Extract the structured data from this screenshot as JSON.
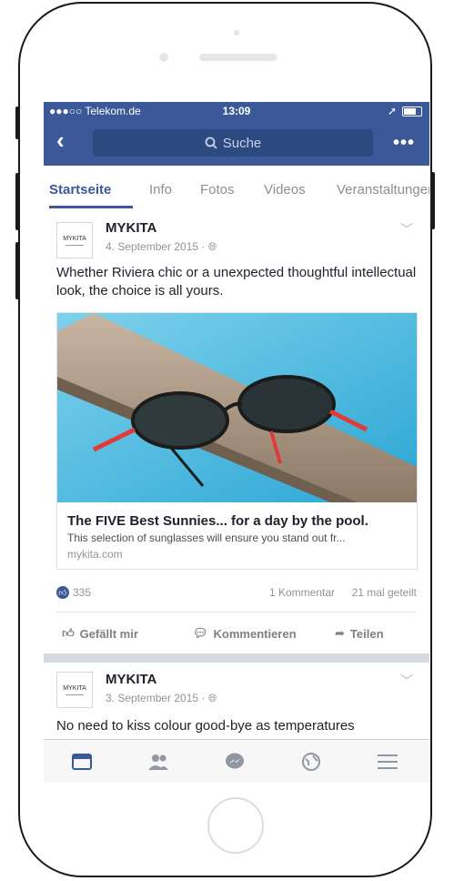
{
  "status_bar": {
    "carrier": "●●●○○ Telekom.de",
    "time": "13:09"
  },
  "navbar": {
    "search_placeholder": "Suche"
  },
  "tabs": [
    {
      "label": "Startseite",
      "active": true
    },
    {
      "label": "Info"
    },
    {
      "label": "Fotos"
    },
    {
      "label": "Videos"
    },
    {
      "label": "Veranstaltungen"
    }
  ],
  "posts": [
    {
      "page": "MYKITA",
      "logo_text": "MYKITA",
      "date": "4. September 2015 · ",
      "text": "Whether Riviera chic or a unexpected thoughtful intellectual look, the choice is all yours.",
      "link": {
        "title": "The FIVE Best Sunnies... for a day by the pool.",
        "description": "This selection of sunglasses will ensure you stand out fr...",
        "domain": "mykita.com"
      },
      "likes": "335",
      "comments": "1 Kommentar",
      "shares": "21 mal geteilt",
      "actions": {
        "like": "Gefällt mir",
        "comment": "Kommentieren",
        "share": "Teilen"
      }
    },
    {
      "page": "MYKITA",
      "logo_text": "MYKITA",
      "date": "3. September 2015 · ",
      "text": "No need to kiss colour good-bye as temperatures"
    }
  ],
  "colors": {
    "brand": "#3b5998",
    "accent_red": "#e23a36"
  }
}
